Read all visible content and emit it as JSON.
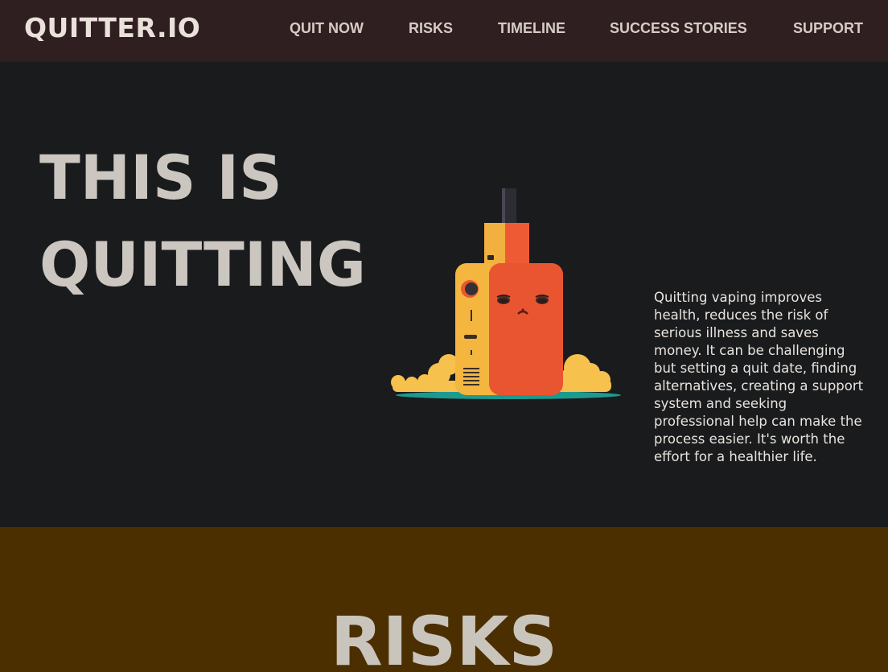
{
  "header": {
    "brand": "QUITTER.IO",
    "nav": [
      "QUIT NOW",
      "RISKS",
      "TIMELINE",
      "SUCCESS STORIES",
      "SUPPORT"
    ]
  },
  "hero": {
    "title_line1": "THIS IS",
    "title_line2": "QUITTING",
    "image_icon": "sad-vape-device-icon",
    "body": "Quitting vaping improves health, reduces the risk of serious illness and saves money. It can be challenging but setting a quit date, finding alternatives, creating a support system and seeking professional help can make the process easier. It's worth the effort for a healthier life."
  },
  "risks": {
    "title": "RISKS"
  },
  "colors": {
    "header_bg": "#2f1f20",
    "hero_bg": "#1a1b1d",
    "risks_bg": "#4c2f00",
    "title_text": "#cbc6bf"
  }
}
